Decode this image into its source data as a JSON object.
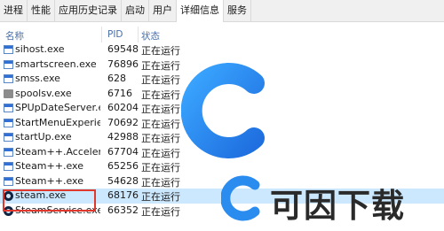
{
  "tabs": [
    {
      "label": "进程"
    },
    {
      "label": "性能"
    },
    {
      "label": "应用历史记录"
    },
    {
      "label": "启动"
    },
    {
      "label": "用户"
    },
    {
      "label": "详细信息",
      "active": true
    },
    {
      "label": "服务"
    }
  ],
  "columns": {
    "name": "名称",
    "pid": "PID",
    "status": "状态"
  },
  "processes": [
    {
      "name": "sihost.exe",
      "pid": "69548",
      "status": "正在运行",
      "icon": "window-icon"
    },
    {
      "name": "smartscreen.exe",
      "pid": "76896",
      "status": "正在运行",
      "icon": "window-icon"
    },
    {
      "name": "smss.exe",
      "pid": "628",
      "status": "正在运行",
      "icon": "window-icon"
    },
    {
      "name": "spoolsv.exe",
      "pid": "6716",
      "status": "正在运行",
      "icon": "printer-icon"
    },
    {
      "name": "SPUpDateServer.exe",
      "pid": "60204",
      "status": "正在运行",
      "icon": "window-icon"
    },
    {
      "name": "StartMenuExperien...",
      "pid": "70692",
      "status": "正在运行",
      "icon": "window-icon"
    },
    {
      "name": "startUp.exe",
      "pid": "42988",
      "status": "正在运行",
      "icon": "window-icon"
    },
    {
      "name": "Steam++.Accelerat...",
      "pid": "67704",
      "status": "正在运行",
      "icon": "window-icon"
    },
    {
      "name": "Steam++.exe",
      "pid": "65256",
      "status": "正在运行",
      "icon": "window-icon"
    },
    {
      "name": "Steam++.exe",
      "pid": "54628",
      "status": "正在运行",
      "icon": "window-icon"
    },
    {
      "name": "steam.exe",
      "pid": "68176",
      "status": "正在运行",
      "icon": "steam-icon",
      "selected": true
    },
    {
      "name": "SteamService.exe",
      "pid": "66352",
      "status": "正在运行",
      "icon": "steam-icon"
    }
  ],
  "watermark": {
    "text": "可因下载"
  },
  "colors": {
    "selected_row": "#cce8ff",
    "highlight_box": "#e0382d",
    "header_text": "#4a6ea8"
  }
}
